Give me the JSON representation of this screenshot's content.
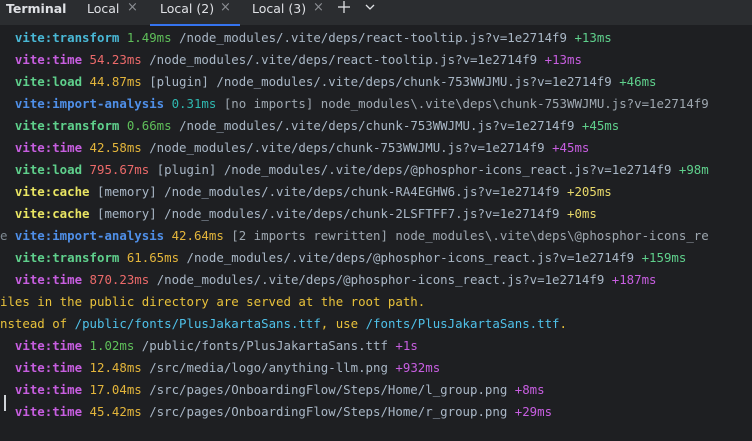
{
  "tabbar": {
    "title": "Terminal",
    "tabs": [
      {
        "label": "Local",
        "close": "×"
      },
      {
        "label": "Local (2)",
        "close": "×"
      },
      {
        "label": "Local (3)",
        "close": "×"
      }
    ],
    "new_tab_icon": "plus-icon",
    "dropdown_icon": "chevron-down-icon"
  },
  "colors": {
    "tab_bar_bg": "#2b2d30",
    "terminal_bg": "#1e1f22",
    "active_tab_underline": "#3574f0"
  },
  "terminal": {
    "lines": [
      {
        "lead": "  ",
        "tag": "vite:transform",
        "ms": "1.49ms",
        "path": "/node_modules/.vite/deps/react-tooltip.js?v=1e2714f9",
        "plus": "+13ms"
      },
      {
        "lead": "  ",
        "tag": "vite:time",
        "ms": "54.23ms",
        "path": "/node_modules/.vite/deps/react-tooltip.js?v=1e2714f9",
        "plus": "+13ms"
      },
      {
        "lead": "  ",
        "tag": "vite:load",
        "ms": "44.87ms",
        "path": "[plugin] /node_modules/.vite/deps/chunk-753WWJMU.js?v=1e2714f9",
        "plus": "+46ms"
      },
      {
        "lead": "  ",
        "tag": "vite:import-analysis",
        "ms": "0.31ms",
        "path": "[no imports] node_modules\\.vite\\deps\\chunk-753WWJMU.js?v=1e2714f9",
        "plus": ""
      },
      {
        "lead": "  ",
        "tag": "vite:transform",
        "ms": "0.66ms",
        "path": "/node_modules/.vite/deps/chunk-753WWJMU.js?v=1e2714f9",
        "plus": "+45ms"
      },
      {
        "lead": "  ",
        "tag": "vite:time",
        "ms": "42.58ms",
        "path": "/node_modules/.vite/deps/chunk-753WWJMU.js?v=1e2714f9",
        "plus": "+45ms"
      },
      {
        "lead": "  ",
        "tag": "vite:load",
        "ms": "795.67ms",
        "path": "[plugin] /node_modules/.vite/deps/@phosphor-icons_react.js?v=1e2714f9",
        "plus": "+98m"
      },
      {
        "lead": "  ",
        "tag": "vite:cache",
        "ms": "",
        "path": "[memory] /node_modules/.vite/deps/chunk-RA4EGHW6.js?v=1e2714f9",
        "plus": "+205ms"
      },
      {
        "lead": "  ",
        "tag": "vite:cache",
        "ms": "",
        "path": "[memory] /node_modules/.vite/deps/chunk-2LSFTFF7.js?v=1e2714f9",
        "plus": "+0ms"
      },
      {
        "lead": "e ",
        "tag": "vite:import-analysis",
        "ms": "42.64ms",
        "path": "[2 imports rewritten] node_modules\\.vite\\deps\\@phosphor-icons_re",
        "plus": ""
      },
      {
        "lead": "  ",
        "tag": "vite:transform",
        "ms": "61.65ms",
        "path": "/node_modules/.vite/deps/@phosphor-icons_react.js?v=1e2714f9",
        "plus": "+159ms"
      },
      {
        "lead": "  ",
        "tag": "vite:time",
        "ms": "870.23ms",
        "path": "/node_modules/.vite/deps/@phosphor-icons_react.js?v=1e2714f9",
        "plus": "+187ms"
      }
    ],
    "warn1": "iles in the public directory are served at the root path.",
    "warn2_a": "nstead of ",
    "warn2_b": "/public/fonts/PlusJakartaSans.ttf",
    "warn2_c": ", use ",
    "warn2_d": "/fonts/PlusJakartaSans.ttf",
    "warn2_e": ".",
    "lines2": [
      {
        "lead": "  ",
        "tag": "vite:time",
        "ms": "1.02ms",
        "path": "/public/fonts/PlusJakartaSans.ttf",
        "plus": "+1s"
      },
      {
        "lead": "  ",
        "tag": "vite:time",
        "ms": "12.48ms",
        "path": "/src/media/logo/anything-llm.png",
        "plus": "+932ms"
      },
      {
        "lead": "  ",
        "tag": "vite:time",
        "ms": "17.04ms",
        "path": "/src/pages/OnboardingFlow/Steps/Home/l_group.png",
        "plus": "+8ms"
      },
      {
        "lead": "  ",
        "tag": "vite:time",
        "ms": "45.42ms",
        "path": "/src/pages/OnboardingFlow/Steps/Home/r_group.png",
        "plus": "+29ms"
      }
    ]
  }
}
